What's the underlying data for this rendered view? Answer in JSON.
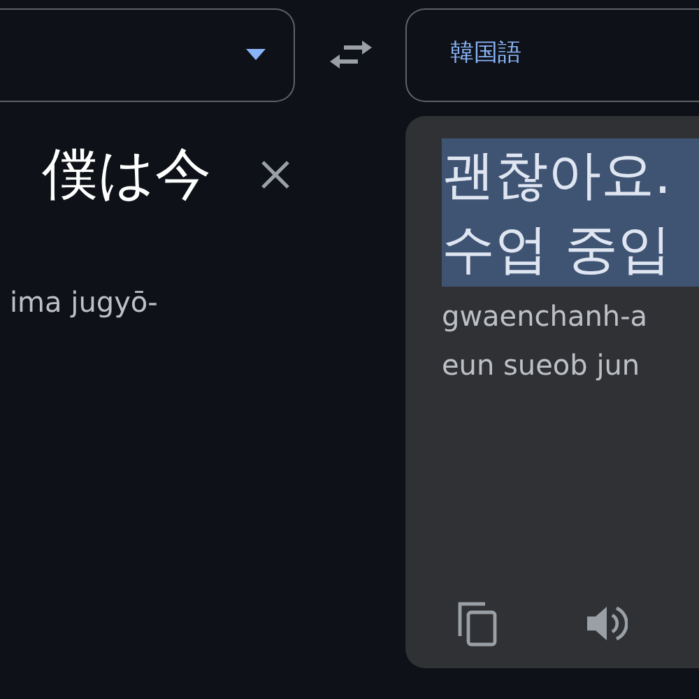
{
  "source": {
    "text": "僕は今",
    "romanization": "ima jugyō-"
  },
  "target": {
    "language": "韓国語",
    "lines": [
      "괜찮아요.",
      "수업 중입"
    ],
    "selected": true,
    "romanization": [
      "gwaenchanh-a",
      "eun sueob jun"
    ]
  }
}
